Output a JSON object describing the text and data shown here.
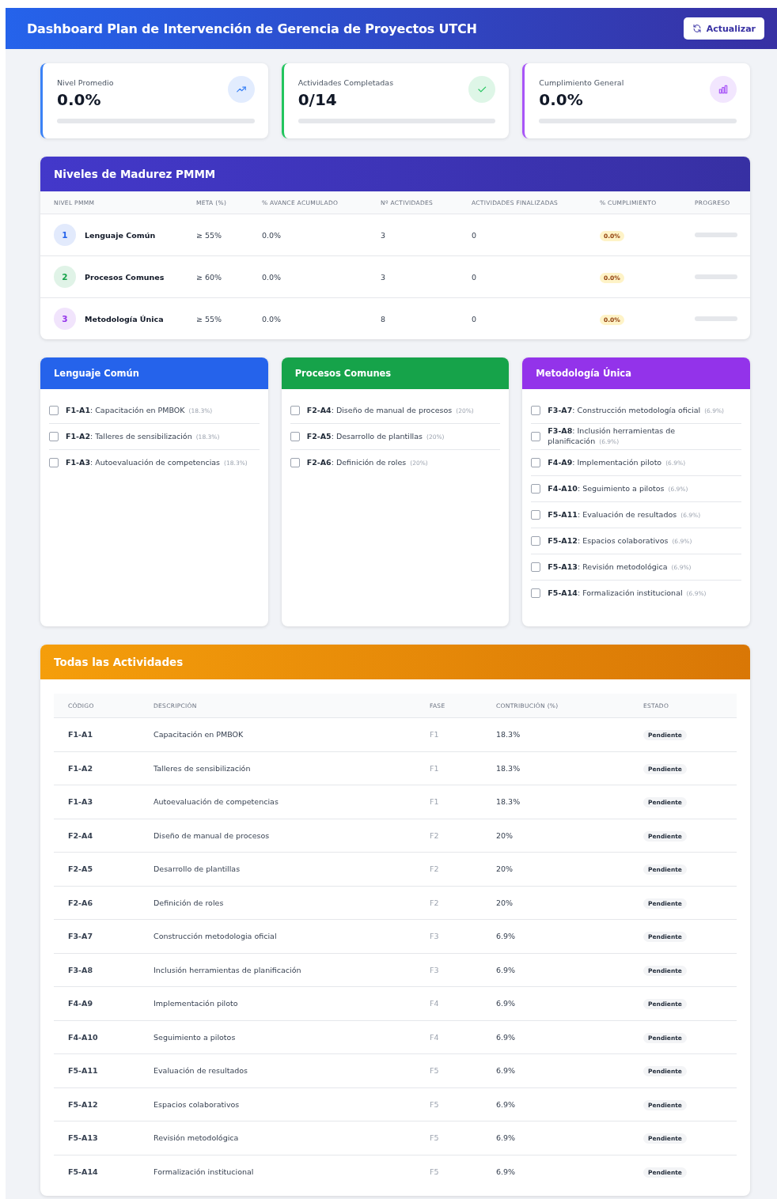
{
  "header": {
    "title": "Dashboard Plan de Intervención de Gerencia de Proyectos UTCH",
    "refresh_button": "Actualizar"
  },
  "stats": [
    {
      "label": "Nivel Promedio",
      "value": "0.0%",
      "level": 0,
      "color": "#3b82f6",
      "kind": "trend"
    },
    {
      "label": "Actividades Completadas",
      "value": "0/14",
      "level": 0,
      "color": "#22c55e",
      "kind": "check"
    },
    {
      "label": "Cumplimiento General",
      "value": "0.0%",
      "level": 0,
      "color": "#a855f7",
      "kind": "chart"
    }
  ],
  "maturity": {
    "title": "Niveles de Madurez PMMM",
    "columns": [
      "NIVEL PMMM",
      "META (%)",
      "% AVANCE ACUMULADO",
      "Nº ACTIVIDADES",
      "ACTIVIDADES FINALIZADAS",
      "% CUMPLIMIENTO",
      "PROGRESO"
    ],
    "rows": [
      {
        "number": "1",
        "name": "Lenguaje Común",
        "meta": "≥ 55%",
        "avance": "0.0%",
        "actividades": "3",
        "finalizadas": "0",
        "cumplimiento": "0.0%",
        "level": 0,
        "color": "#2563eb"
      },
      {
        "number": "2",
        "name": "Procesos Comunes",
        "meta": "≥ 60%",
        "avance": "0.0%",
        "actividades": "3",
        "finalizadas": "0",
        "cumplimiento": "0.0%",
        "level": 0,
        "color": "#16a34a"
      },
      {
        "number": "3",
        "name": "Metodología Única",
        "meta": "≥ 55%",
        "avance": "0.0%",
        "actividades": "8",
        "finalizadas": "0",
        "cumplimiento": "0.0%",
        "level": 0,
        "color": "#9333ea"
      }
    ]
  },
  "phases": [
    {
      "title": "Lenguaje Común",
      "color": "#2563eb",
      "activities": [
        {
          "label": "**F1-A1**: Capacitación en PMBOK",
          "contribution": "(18.3%)",
          "checked": false
        },
        {
          "label": "**F1-A2**: Talleres de sensibilización",
          "contribution": "(18.3%)",
          "checked": false
        },
        {
          "label": "**F1-A3**: Autoevaluación de competencias",
          "contribution": "(18.3%)",
          "checked": false
        }
      ]
    },
    {
      "title": "Procesos Comunes",
      "color": "#16a34a",
      "activities": [
        {
          "label": "**F2-A4**: Diseño de manual de procesos",
          "contribution": "(20%)",
          "checked": false
        },
        {
          "label": "**F2-A5**: Desarrollo de plantillas",
          "contribution": "(20%)",
          "checked": false
        },
        {
          "label": "**F2-A6**: Definición de roles",
          "contribution": "(20%)",
          "checked": false
        }
      ]
    },
    {
      "title": "Metodología Única",
      "color": "#9333ea",
      "activities": [
        {
          "label": "**F3-A7**: Construcción metodología oficial",
          "contribution": "(6.9%)",
          "checked": false
        },
        {
          "label": "**F3-A8**: Inclusión herramientas de planificación",
          "contribution": "(6.9%)",
          "checked": false
        },
        {
          "label": "**F4-A9**: Implementación piloto",
          "contribution": "(6.9%)",
          "checked": false
        },
        {
          "label": "**F4-A10**: Seguimiento a pilotos",
          "contribution": "(6.9%)",
          "checked": false
        },
        {
          "label": "**F5-A11**: Evaluación de resultados",
          "contribution": "(6.9%)",
          "checked": false
        },
        {
          "label": "**F5-A12**: Espacios colaborativos",
          "contribution": "(6.9%)",
          "checked": false
        },
        {
          "label": "**F5-A13**: Revisión metodológica",
          "contribution": "(6.9%)",
          "checked": false
        },
        {
          "label": "**F5-A14**: Formalización institucional",
          "contribution": "(6.9%)",
          "checked": false
        }
      ]
    }
  ],
  "activities": {
    "title": "Todas las Actividades",
    "columns": [
      "CÓDIGO",
      "DESCRIPCIÓN",
      "FASE",
      "CONTRIBUCIÓN (%)",
      "ESTADO"
    ],
    "rows": [
      {
        "code": "F1-A1",
        "description": "Capacitación en PMBOK",
        "phase": "F1",
        "contribution": "18.3%",
        "status": "Pendiente"
      },
      {
        "code": "F1-A2",
        "description": "Talleres de sensibilización",
        "phase": "F1",
        "contribution": "18.3%",
        "status": "Pendiente"
      },
      {
        "code": "F1-A3",
        "description": "Autoevaluación de competencias",
        "phase": "F1",
        "contribution": "18.3%",
        "status": "Pendiente"
      },
      {
        "code": "F2-A4",
        "description": "Diseño de manual de procesos",
        "phase": "F2",
        "contribution": "20%",
        "status": "Pendiente"
      },
      {
        "code": "F2-A5",
        "description": "Desarrollo de plantillas",
        "phase": "F2",
        "contribution": "20%",
        "status": "Pendiente"
      },
      {
        "code": "F2-A6",
        "description": "Definición de roles",
        "phase": "F2",
        "contribution": "20%",
        "status": "Pendiente"
      },
      {
        "code": "F3-A7",
        "description": "Construcción metodologia oficial",
        "phase": "F3",
        "contribution": "6.9%",
        "status": "Pendiente"
      },
      {
        "code": "F3-A8",
        "description": "Inclusión herramientas de planificación",
        "phase": "F3",
        "contribution": "6.9%",
        "status": "Pendiente"
      },
      {
        "code": "F4-A9",
        "description": "Implementación piloto",
        "phase": "F4",
        "contribution": "6.9%",
        "status": "Pendiente"
      },
      {
        "code": "F4-A10",
        "description": "Seguimiento a pilotos",
        "phase": "F4",
        "contribution": "6.9%",
        "status": "Pendiente"
      },
      {
        "code": "F5-A11",
        "description": "Evaluación de resultados",
        "phase": "F5",
        "contribution": "6.9%",
        "status": "Pendiente"
      },
      {
        "code": "F5-A12",
        "description": "Espacios colaborativos",
        "phase": "F5",
        "contribution": "6.9%",
        "status": "Pendiente"
      },
      {
        "code": "F5-A13",
        "description": "Revisión metodológica",
        "phase": "F5",
        "contribution": "6.9%",
        "status": "Pendiente"
      },
      {
        "code": "F5-A14",
        "description": "Formalización institucional",
        "phase": "F5",
        "contribution": "6.9%",
        "status": "Pendiente"
      }
    ]
  }
}
